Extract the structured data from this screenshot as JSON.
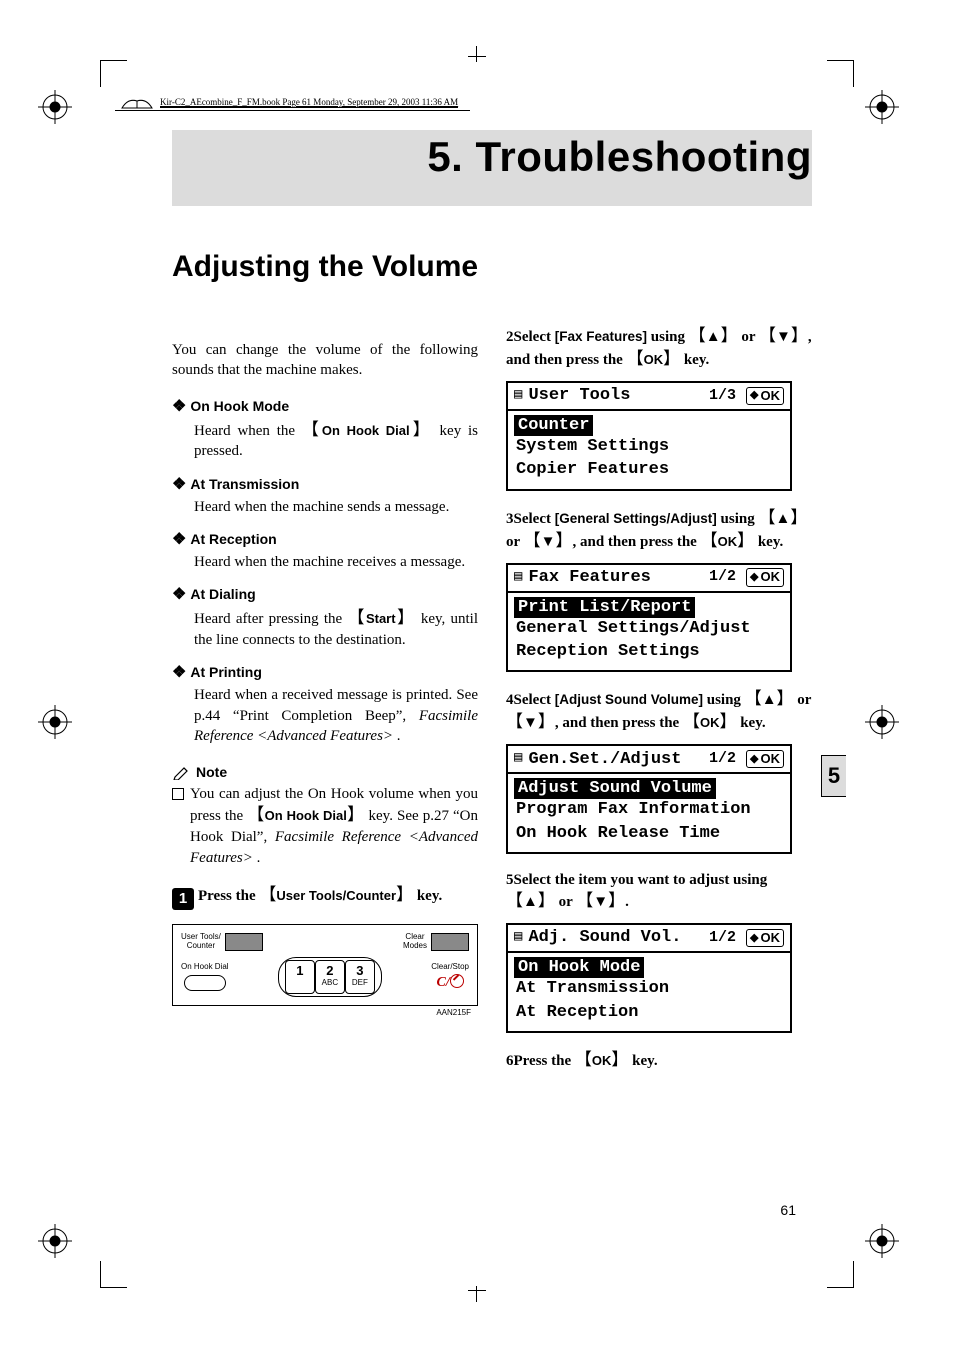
{
  "slug": {
    "text": "Kir-C2_AEcombine_F_FM.book  Page 61  Monday, September 29, 2003  11:36 AM"
  },
  "chapter": {
    "number": "5.",
    "name": "Troubleshooting"
  },
  "section_title": "Adjusting the Volume",
  "intro": "You can change the volume of the following sounds that the machine makes.",
  "modes": {
    "on_hook": {
      "title": "On Hook Mode",
      "body_a": "Heard when the ",
      "key": "On Hook Dial",
      "body_b": " key is pressed."
    },
    "at_tx": {
      "title": "At Transmission",
      "body": "Heard when the machine sends a message."
    },
    "at_rx": {
      "title": "At Reception",
      "body": "Heard when the machine receives a message."
    },
    "at_dial": {
      "title": "At Dialing",
      "body_a": "Heard after pressing the ",
      "key": "Start",
      "body_b": " key, until the line connects to the destination."
    },
    "at_print": {
      "title": "At Printing",
      "body_a": "Heard when a received message is printed. See p.44 “Print Completion Beep”, ",
      "ref": "Facsimile Reference <Advanced Features>",
      "body_b": " ."
    }
  },
  "note": {
    "label": "Note",
    "body_a": "You can adjust the On Hook volume when you press the ",
    "key": "On Hook Dial",
    "body_b": " key. See p.27 “On Hook Dial”, ",
    "ref": "Facsimile Reference <Advanced Features>",
    "body_c": " ."
  },
  "steps": {
    "s1": {
      "n": "1",
      "a": "Press the ",
      "key": "User Tools/Counter",
      "b": " key."
    },
    "s2": {
      "n": "2",
      "a": "Select ",
      "opt": "[Fax Features]",
      "b": " using ",
      "c": " or ",
      "d": ", and then press the ",
      "key": "OK",
      "e": " key."
    },
    "s3": {
      "n": "3",
      "a": "Select ",
      "opt": "[General Settings/Adjust]",
      "b": " using ",
      "c": " or ",
      "d": ", and then press the ",
      "key": "OK",
      "e": " key."
    },
    "s4": {
      "n": "4",
      "a": "Select ",
      "opt": "[Adjust Sound Volume]",
      "b": " using ",
      "c": " or ",
      "d": ", and then press the ",
      "key": "OK",
      "e": " key."
    },
    "s5": {
      "n": "5",
      "a": "Select the item you want to adjust using ",
      "b": " or ",
      "c": "."
    },
    "s6": {
      "n": "6",
      "a": "Press the ",
      "key": "OK",
      "b": " key."
    }
  },
  "lcd": {
    "l1": {
      "title": "User Tools",
      "page": "1/3",
      "rows": [
        "Counter",
        "System Settings",
        "Copier Features"
      ],
      "sel": 0
    },
    "l2": {
      "title": "Fax Features",
      "page": "1/2",
      "rows": [
        "Print List/Report",
        "General Settings/Adjust",
        "Reception Settings"
      ],
      "sel": 0
    },
    "l3": {
      "title": "Gen.Set./Adjust",
      "page": "1/2",
      "rows": [
        "Adjust Sound Volume",
        "Program Fax Information",
        "On Hook Release Time"
      ],
      "sel": 0
    },
    "l4": {
      "title": "Adj. Sound Vol.",
      "page": "1/2",
      "rows": [
        "On Hook Mode",
        "At Transmission",
        "At Reception"
      ],
      "sel": 0
    }
  },
  "keyfig": {
    "ut": "User Tools/\nCounter",
    "cm": "Clear\nModes",
    "ohd": "On Hook Dial",
    "k1": "1",
    "k2": "2",
    "k2s": "ABC",
    "k3": "3",
    "k3s": "DEF",
    "cs": "Clear/Stop",
    "code": "AAN215F",
    "cslogo": "C/"
  },
  "pagenum": "61",
  "tabnum": "5",
  "glyphs": {
    "diamond": "❖",
    "up": "▲",
    "down": "▼",
    "lb": "【",
    "rb": "】",
    "menu": "▤",
    "arrud": "◆",
    "ok": "OK"
  }
}
